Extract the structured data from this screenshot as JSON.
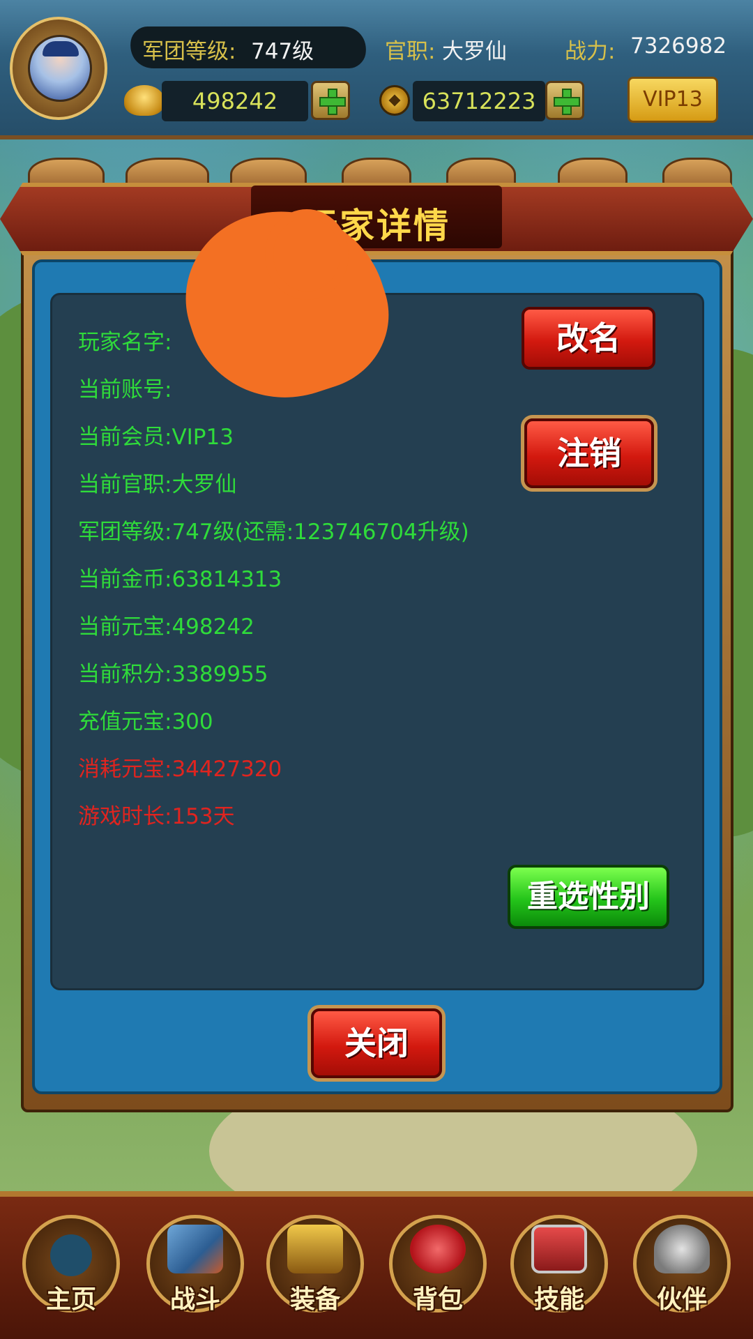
{
  "top": {
    "legion_level_label": "军团等级:",
    "legion_level_value": "747级",
    "rank_label": "官职:",
    "rank_value": "大罗仙",
    "power_label": "战力:",
    "power_value": "7326982",
    "ingots": "498242",
    "gold": "63712223",
    "vip": "VIP13"
  },
  "dialog": {
    "title": "玩家详情",
    "lines": [
      {
        "label": "玩家名字:",
        "value": ""
      },
      {
        "label": "当前账号:",
        "value": ""
      },
      {
        "label": "当前会员:",
        "value": "VIP13"
      },
      {
        "label": "当前官职:",
        "value": "大罗仙"
      },
      {
        "label": "军团等级:",
        "value": "747级(还需:123746704升级)"
      },
      {
        "label": "当前金币:",
        "value": "63814313"
      },
      {
        "label": "当前元宝:",
        "value": "498242"
      },
      {
        "label": "当前积分:",
        "value": "3389955"
      },
      {
        "label": "充值元宝:",
        "value": "300"
      },
      {
        "label": "消耗元宝:",
        "value": "34427320"
      },
      {
        "label": "游戏时长:",
        "value": "153天"
      }
    ],
    "rename_button": "改名",
    "logout_button": "注销",
    "reselect_gender_button": "重选性别",
    "close_button": "关闭"
  },
  "bottom_nav": [
    "主页",
    "战斗",
    "装备",
    "背包",
    "技能",
    "伙伴"
  ],
  "colors": {
    "green_text": "#2fdc3a",
    "red_text": "#e0241f",
    "title": "#ffd84a"
  }
}
